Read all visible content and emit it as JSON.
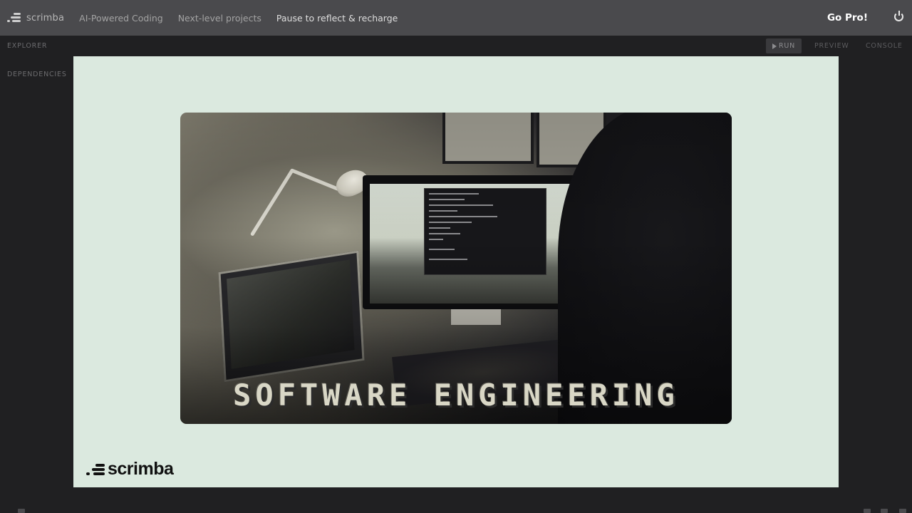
{
  "nav": {
    "brand": "scrimba",
    "links": [
      "AI-Powered Coding",
      "Next-level projects",
      "Pause to reflect & recharge"
    ],
    "cta": "Go Pro!"
  },
  "sidebar": {
    "explorer": "EXPLORER",
    "dependencies": "DEPENDENCIES"
  },
  "toolbar": {
    "run": "RUN",
    "preview": "PREVIEW",
    "console": "CONSOLE"
  },
  "slide": {
    "caption": "SOFTWARE ENGINEERING",
    "logo": "scrimba",
    "background": "#dbe9df"
  },
  "icons": [
    "scrimba-logo-icon",
    "power-icon",
    "play-icon"
  ]
}
